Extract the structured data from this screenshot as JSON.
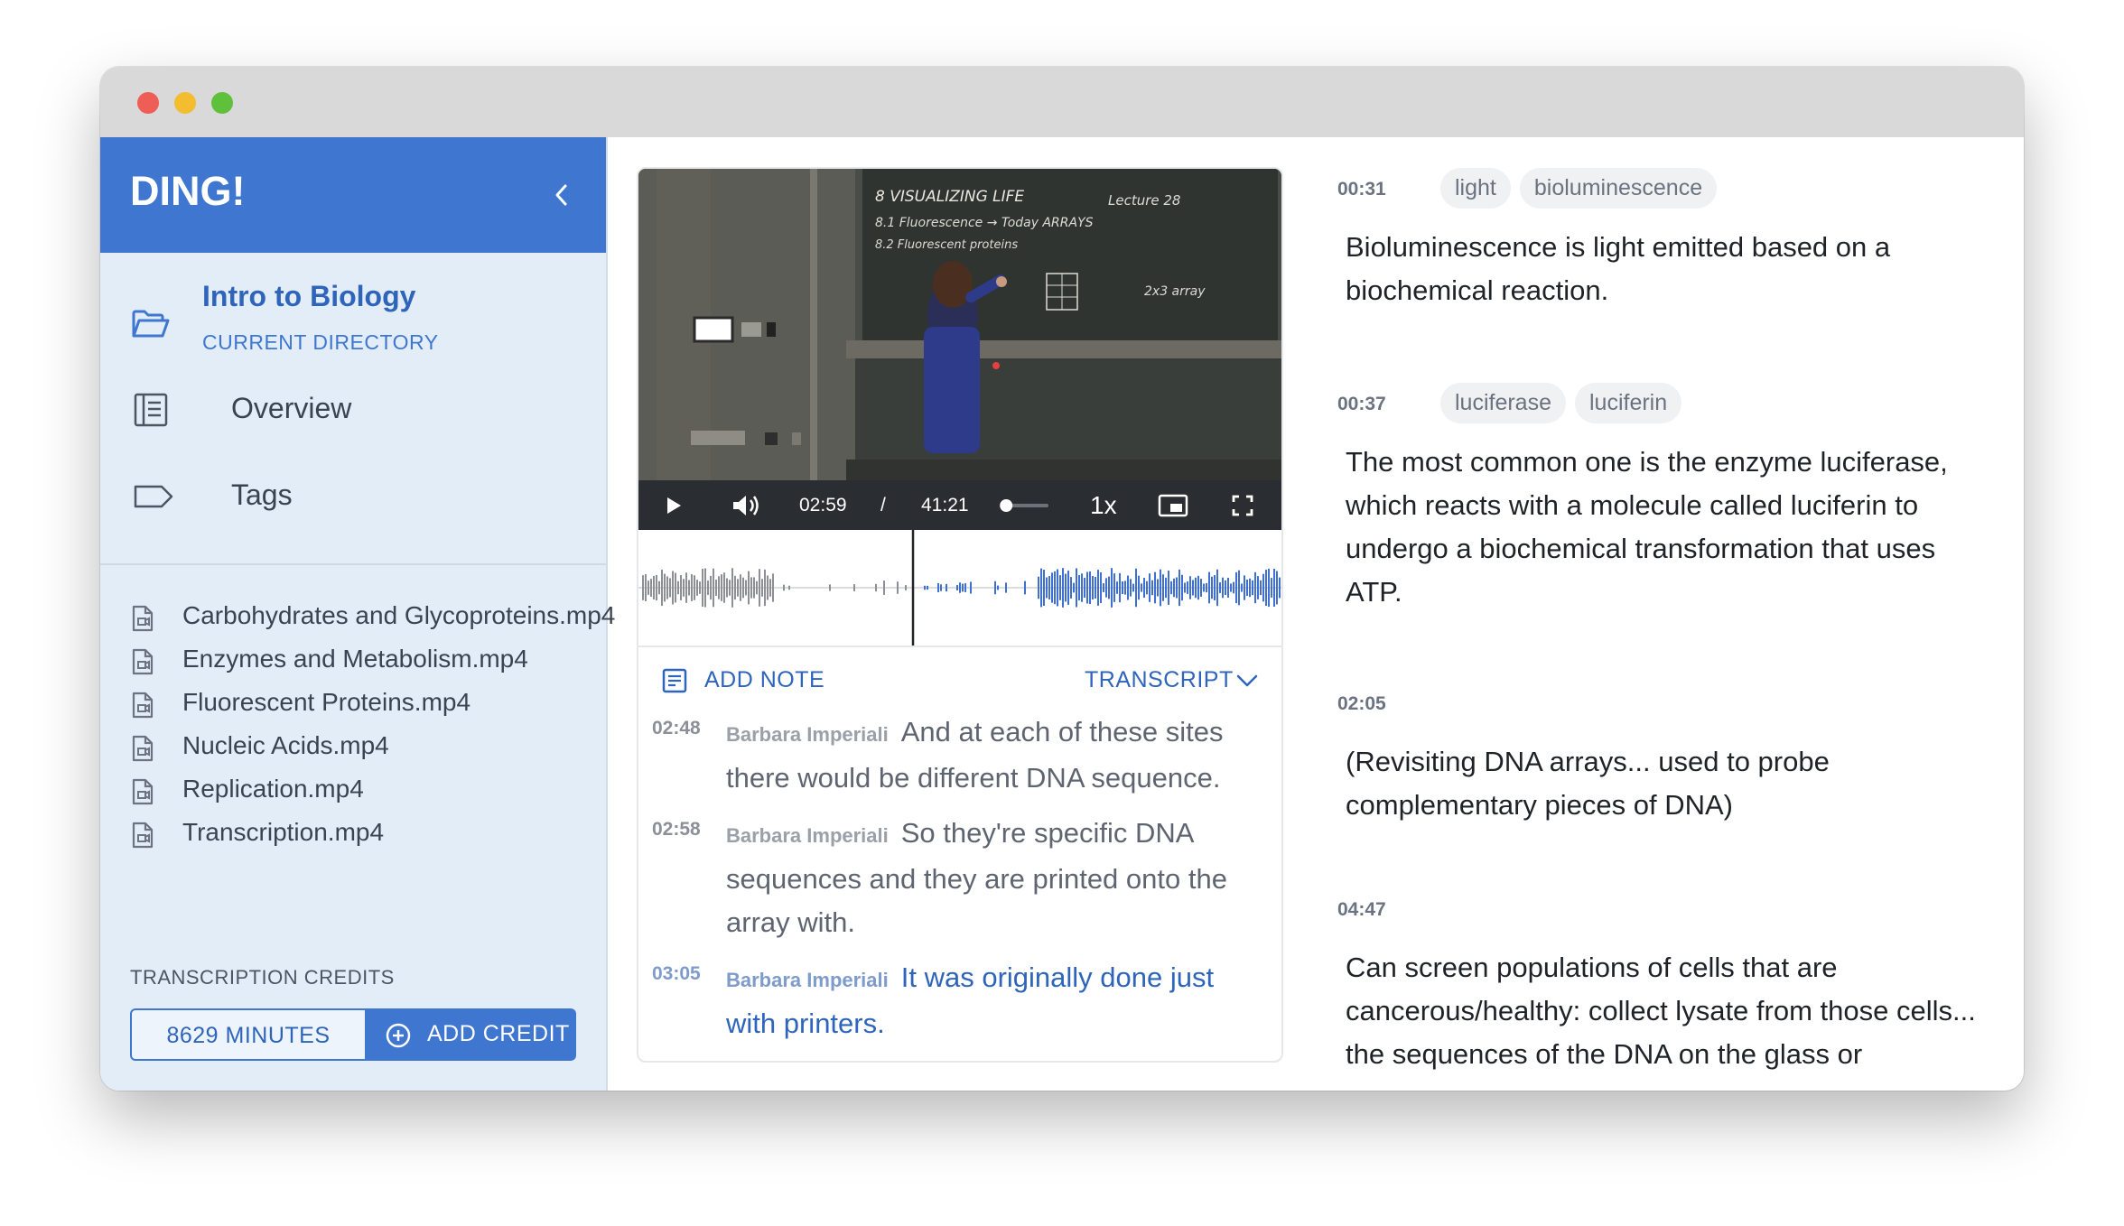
{
  "app": {
    "name": "DING!"
  },
  "colors": {
    "brand": "#3f77d0",
    "sidebar_bg": "#e3edf8",
    "waveform": "#3f6fd0"
  },
  "sidebar": {
    "directory": {
      "name": "Intro to Biology",
      "subtitle": "CURRENT DIRECTORY",
      "icon": "folder-open-icon"
    },
    "nav": [
      {
        "label": "Overview",
        "icon": "overview-icon"
      },
      {
        "label": "Tags",
        "icon": "tag-icon"
      }
    ],
    "files": [
      "Carbohydrates and Glycoproteins.mp4",
      "Enzymes and Metabolism.mp4",
      "Fluorescent Proteins.mp4",
      "Nucleic Acids.mp4",
      "Replication.mp4",
      "Transcription.mp4"
    ],
    "credits": {
      "label": "TRANSCRIPTION CREDITS",
      "minutes": "8629 MINUTES",
      "add_label": "ADD CREDIT"
    }
  },
  "player": {
    "current_time": "02:59",
    "separator": "/",
    "duration": "41:21",
    "speed": "1x",
    "progress_fraction": 0.072,
    "volume_fraction": 0.1,
    "board_lines": [
      "8 VISUALIZING LIFE",
      "8.1 Fluorescence → Today ARRAYS",
      "8.2 Fluorescent proteins",
      "Lecture 28",
      "2x3 array"
    ]
  },
  "transcript": {
    "add_note_label": "ADD NOTE",
    "toggle_label": "TRANSCRIPT",
    "lines": [
      {
        "time": "02:48",
        "speaker": "Barbara Imperiali",
        "text": "And at each of these sites there would be different DNA sequence.",
        "active": false
      },
      {
        "time": "02:58",
        "speaker": "Barbara Imperiali",
        "text": "So they're specific DNA sequences and they are printed onto the array with.",
        "active": false
      },
      {
        "time": "03:05",
        "speaker": "Barbara Imperiali",
        "text": "It was originally done just with printers.",
        "active": true
      }
    ]
  },
  "notes": [
    {
      "time": "00:31",
      "tags": [
        "light",
        "bioluminescence"
      ],
      "text": "Bioluminescence is light emitted based on a biochemical reaction."
    },
    {
      "time": "00:37",
      "tags": [
        "luciferase",
        "luciferin"
      ],
      "text": "The most common one is the enzyme luciferase, which reacts with a molecule called luciferin to undergo a biochemical transformation that uses ATP."
    },
    {
      "time": "02:05",
      "tags": [],
      "text": "(Revisiting DNA arrays... used to probe complementary pieces of DNA)"
    },
    {
      "time": "04:47",
      "tags": [],
      "text": "Can screen populations of cells that are cancerous/healthy: collect lysate from those cells... the sequences of the DNA on the glass or"
    }
  ]
}
